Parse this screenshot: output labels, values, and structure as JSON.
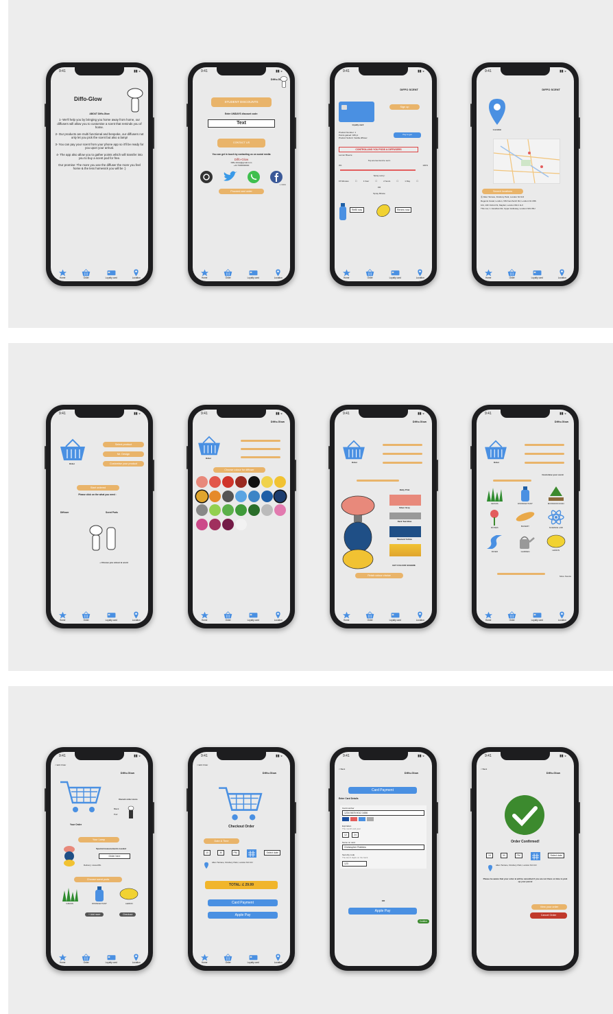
{
  "tabs": [
    {
      "icon": "star-icon",
      "label": "Home"
    },
    {
      "icon": "basket-icon",
      "label": "Order"
    },
    {
      "icon": "card-icon",
      "label": "Loyalty card"
    },
    {
      "icon": "pin-icon",
      "label": "Location"
    }
  ],
  "brand": "Diffo-Glow",
  "status_time": "9:41",
  "screens": {
    "about": {
      "app_title": "Diffo-Glow",
      "heading": "ABOUT Diffo-Glow",
      "p1": "1- We'll help you by bringing you home away from home, our diffusers will allow you to customise a scent that reminds you of home.",
      "p2": "2- Our products are multi functional and bespoke, our diffusers not only let you pick the scent but also a lamp!",
      "p3": "3- You can pay your scent from your phone app so it'll be ready for you upon your arrival.",
      "p4": "4- The app also allow you to gather points which will transfer into you to buy a scent pod for free.",
      "p5": "Our promise: The more you use the diffuser the more you feel home & the less homesick you will be :)"
    },
    "contact": {
      "discount_btn": "STUDENT DISCOUNTS",
      "enter_label": "Enter UNIDAYS discount code:",
      "code_value": "Text",
      "contact_btn": "CONTACT US",
      "social_label": "You can get in touch by contacting us on social media",
      "handle": "Diffo-Glow",
      "email": "Diffo-Glow@gmail.com",
      "phone": "+44 7900000000",
      "proceed_btn": "Proceed and order",
      "more": "+ more"
    },
    "loyalty": {
      "header": "DIFFO SCENT",
      "sign_up": "Sign up",
      "card_label": "loyalty card",
      "product_number": "Product Number: 1",
      "points": "Points gained: 180 pt",
      "fragrance": "Product Submit: Vanilla diffuser",
      "pay_btn": "Pay to get",
      "warning": "CONTROLLING YOU PODS & DIFFUSERS",
      "lemon_label": "Lemon Breeze",
      "level": "Top aroma trend to set it",
      "pct_lo": "0%",
      "pct_hi": "100%",
      "spray_label": "Spray every:",
      "intervals": [
        "15 Minutes",
        "1 hour",
        "2 hours",
        "1 Day"
      ],
      "or": "OR",
      "spray_minute": "Spray Minute",
      "refill_btn": "Refill now",
      "renew_btn": "Renew now"
    },
    "location": {
      "header": "DIFFO SCENT",
      "pin_label": "Location",
      "search_btn": "Search locations",
      "addr1": "Allen Terrace, Finsbury Park, London N4 3JJ",
      "addr2": "Regents Canal, London, NW Fenchurch Rd, London N1 1BS",
      "addr3": "101, 10F Oxford St, Mayfair, London W1C 1LX",
      "addr4": "This row, 1 Jonathan Rd, Upper Holloway, London N19 3SU"
    },
    "order1": {
      "order_label": "Order",
      "opt1": "Select product",
      "opt2": "Mr. Design",
      "opt3": "Customise your product",
      "start_btn": "Start ordered",
      "prompt": "Please click on the what you need :",
      "diffuser": "Diffuser",
      "scent": "Scent Pods",
      "choose": "+ Choose you colour & scent"
    },
    "colors": {
      "order_label": "Order",
      "choose_btn": "Choose colour for diffuser",
      "palette": [
        "#e8897b",
        "#e2574b",
        "#d0342a",
        "#9a2a20",
        "#111111",
        "#f0d24a",
        "#f1c232",
        "#e0a52e",
        "#e58a2a",
        "#555555",
        "#5aa4e2",
        "#3d85c6",
        "#1f5fa6",
        "#1c3d6e",
        "#888888",
        "#92d050",
        "#5bb04a",
        "#3f9a3a",
        "#2b6e2a",
        "#bbbbbb",
        "#e27aaf",
        "#cc4a8a",
        "#a0305e",
        "#741b47",
        "#f2f2f2"
      ]
    },
    "preview": {
      "order_label": "Order",
      "baby_pink": "Baby Pink",
      "silver_grey": "Silver Grey",
      "dark_teal": "Dark Teal Blue",
      "mustard": "Mustard Yellow",
      "combo_btn": "Finish colour choice",
      "footer_note": "GET COLOUR SCHEME"
    },
    "scents": {
      "order_label": "Order",
      "customise": "Customise your scent",
      "items": [
        "GRASS",
        "DISINFECTANT",
        "MONSOON RAIN",
        "ROSES",
        "BAKERY",
        "SCIENCE LAB",
        "RIVER",
        "GARDEN",
        "LEMON"
      ],
      "more": "More Scents"
    },
    "basket": {
      "back": "< Edit Order",
      "your_order": "Your Order",
      "recent": "Recent order icons",
      "disp_pods": "Black",
      "pods_label": "Pod",
      "edit_btn": "Your Lamp",
      "special": "Special measurements needed",
      "note": "Order here",
      "deliver": "Delivery: www.diffo",
      "choose_scents": "Choose scent pods",
      "items": [
        "GRASS",
        "DISINFECTANT",
        "LEMON"
      ],
      "add_btn": "+ Add more",
      "checkout_btn": "Checkout"
    },
    "checkout": {
      "back": "< Edit Order",
      "title": "Checkout Order",
      "time_label": "Date & Time",
      "hour": "10",
      "minute": "30",
      "ampm": "PM",
      "date": "Select date",
      "address": "Allen Terrace, Finsbury Park, London N4 3JJ",
      "total": "TOTAL: £ 29.99",
      "card_btn": "Card Payment",
      "apple_btn": "Apple Pay"
    },
    "card": {
      "back": "< Back",
      "card_btn": "Card Payment",
      "heading": "Enter Card Details",
      "card_number_label": "Card number",
      "card_number": "1234 5678 9012 3456",
      "expiry_label": "Expiration",
      "expiry_hint": "The month and year",
      "month": "12",
      "year": "24",
      "name_label": "Name on card",
      "name": "Christopher Robbins",
      "cvv_label": "Security code",
      "cvv_hint": "The last 3 digits on the back",
      "cvv": "123",
      "or": "OR",
      "apple_btn": "Apple Pay",
      "confirm": "Confirm"
    },
    "confirmed": {
      "back": "< Back",
      "title": "Order Confirmed!",
      "hour": "10",
      "minute": "30",
      "ampm": "PM",
      "date": "Select date",
      "address": "Allen Terrace, Finsbury Park, London N4 3JJ",
      "notice": "Please be aware that your order & will be cancelled if you are not there on time to pick up your parcel",
      "view_btn": "View your order",
      "cancel_btn": "Cancel Order"
    }
  },
  "colors": {
    "blue": "#4a90e2",
    "orange": "#e9b46a",
    "red": "#c0392b",
    "green": "#3c8a2e"
  }
}
